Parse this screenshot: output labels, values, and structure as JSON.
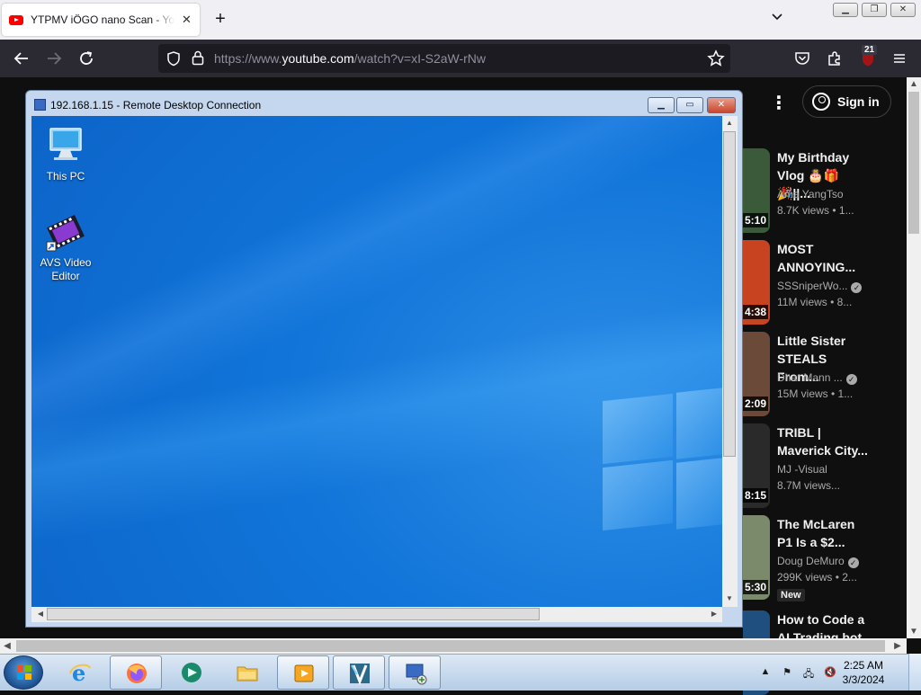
{
  "browser": {
    "tab_title": "YTPMV iÖGO nano Scan - YouTube",
    "tab_close": "✕",
    "new_tab": "+",
    "url_prefix": "https://www.",
    "url_host": "youtube.com",
    "url_path": "/watch?v=xI-S2aW-rNw",
    "extension_badge": "21"
  },
  "youtube": {
    "sign_in": "Sign in",
    "videos": [
      {
        "title": "My Birthday Vlog 🎂🎁🎉||...",
        "channel": "Ama YangTso",
        "verified": false,
        "meta": "8.7K views  •  1...",
        "duration": "5:10",
        "thumb": "#3a5a3a"
      },
      {
        "title": "MOST ANNOYING...",
        "channel": "SSSniperWo...",
        "verified": true,
        "meta": "11M views  •  8...",
        "duration": "4:38",
        "thumb": "#c8431f"
      },
      {
        "title": "Little Sister STEALS From...",
        "channel": "Dhar Mann ...",
        "verified": true,
        "meta": "15M views  •  1...",
        "duration": "2:09",
        "thumb": "#6b4a3a"
      },
      {
        "title": "TRIBL | Maverick City...",
        "channel": "MJ -Visual",
        "verified": false,
        "meta": "8.7M views...",
        "duration": "8:15",
        "thumb": "#2a2a2a"
      },
      {
        "title": "The McLaren P1 Is a $2...",
        "channel": "Doug DeMuro",
        "verified": true,
        "meta": "299K views  •  2...",
        "duration": "5:30",
        "thumb": "#7a8a6a",
        "badge": "New"
      },
      {
        "title": "How to Code a AI Trading bot",
        "channel": "",
        "verified": false,
        "meta": "",
        "duration": "",
        "thumb": "#1f4f7f"
      }
    ]
  },
  "rdp": {
    "title": "192.168.1.15 - Remote Desktop Connection",
    "icons": [
      {
        "label": "This PC"
      },
      {
        "label": "AVS Video Editor"
      }
    ]
  },
  "taskbar": {
    "time": "2:25 AM",
    "date": "3/3/2024"
  },
  "colors": {
    "firefox_nav": "#2b2a33",
    "youtube_bg": "#0f0f0f",
    "win10_blue": "#1175d9"
  }
}
